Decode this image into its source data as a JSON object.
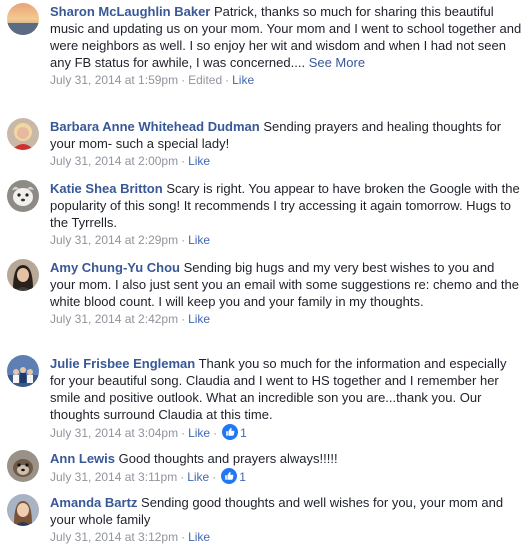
{
  "comments": [
    {
      "author": "Sharon McLaughlin Baker",
      "text": "Patrick, thanks so much for sharing this beautiful music and updating us on your mom. Your mom and I went to school together and were neighbors as well. I so enjoy her wit and wisdom and when I had not seen any FB status for awhile, I was concerned....",
      "see_more": "See More",
      "timestamp": "July 31, 2014 at 1:59pm",
      "edited": "Edited",
      "like": "Like",
      "avatar_icon": "sunset-avatar-icon"
    },
    {
      "author": "Barbara Anne Whitehead Dudman",
      "text": "Sending prayers and healing thoughts for your mom- such a special lady!",
      "timestamp": "July 31, 2014 at 2:00pm",
      "like": "Like",
      "avatar_icon": "woman-blonde-avatar-icon"
    },
    {
      "author": "Katie Shea Britton",
      "text": "Scary is right. You appear to have broken the Google with the popularity of this song! It recommends I try accessing it again tomorrow. Hugs to the Tyrrells.",
      "timestamp": "July 31, 2014 at 2:29pm",
      "like": "Like",
      "avatar_icon": "dog-avatar-icon"
    },
    {
      "author": "Amy Chung-Yu Chou",
      "text": "Sending big hugs and my very best wishes to you and your mom. I also just sent you an email with some suggestions re: chemo and the white blood count. I will keep you and your family in my thoughts.",
      "timestamp": "July 31, 2014 at 2:42pm",
      "like": "Like",
      "avatar_icon": "woman-dark-hair-avatar-icon"
    },
    {
      "author": "Julie Frisbee Engleman",
      "text": "Thank you so much for the information and especially for your beautiful song. Claudia and I went to HS together and I remember her smile and positive outlook. What an incredible son you are...thank you. Our thoughts surround Claudia at this time.",
      "timestamp": "July 31, 2014 at 3:04pm",
      "like": "Like",
      "reaction_count": "1",
      "avatar_icon": "group-avatar-icon"
    },
    {
      "author": "Ann Lewis",
      "text": "Good thoughts and prayers always!!!!!",
      "timestamp": "July 31, 2014 at 3:11pm",
      "like": "Like",
      "reaction_count": "1",
      "avatar_icon": "dog-small-avatar-icon"
    },
    {
      "author": "Amanda Bartz",
      "text": "Sending good thoughts and well wishes for you, your mom and your whole family",
      "timestamp": "July 31, 2014 at 3:12pm",
      "like": "Like",
      "avatar_icon": "woman-avatar-icon"
    }
  ],
  "colors": {
    "author": "#385898",
    "link": "#4267b2",
    "meta": "#90949c",
    "text": "#1d2129",
    "like_reaction": "#2078f4"
  },
  "icons": {
    "like_reaction": "thumbs-up-reaction-icon"
  }
}
